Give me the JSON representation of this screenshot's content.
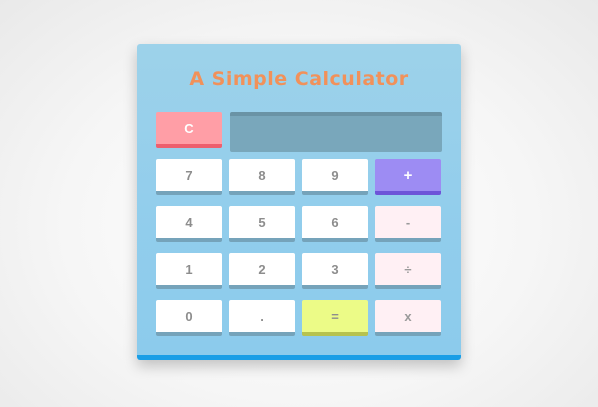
{
  "calculator": {
    "title": "A Simple Calculator",
    "display_value": "",
    "keys": {
      "clear": "C",
      "seven": "7",
      "eight": "8",
      "nine": "9",
      "plus": "+",
      "four": "4",
      "five": "5",
      "six": "6",
      "minus": "-",
      "one": "1",
      "two": "2",
      "three": "3",
      "divide": "÷",
      "zero": "0",
      "decimal": ".",
      "equals": "=",
      "multiply": "x"
    }
  },
  "colors": {
    "panel_background": "#95cfeb",
    "panel_bottom_border": "#1a9ee6",
    "title_text": "#f1915a",
    "display_background": "#79a7bb",
    "clear_key": "#ff9ea6",
    "plus_key": "#9d8cf3",
    "equals_key": "#ecfb87",
    "operator_key": "#fff0f4",
    "number_key": "#ffffff",
    "key_text": "#8d8d8d"
  }
}
